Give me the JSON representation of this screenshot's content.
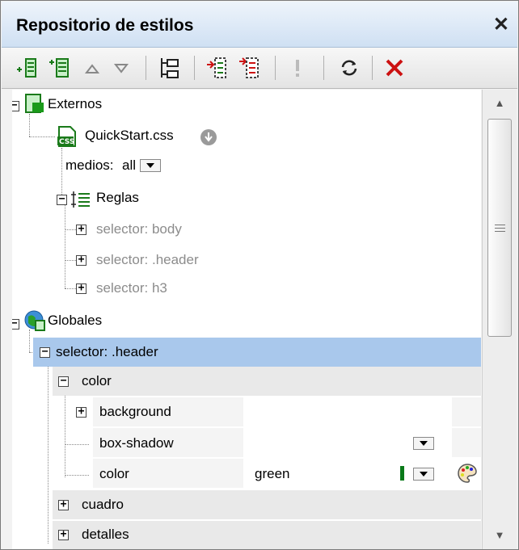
{
  "panel": {
    "title": "Repositorio de estilos",
    "close_label": "✕"
  },
  "toolbar": {
    "buttons": [
      "add-stylesheet-icon",
      "add-stylesheet-before-icon",
      "move-up-icon",
      "move-down-icon",
      "collapse-all-icon",
      "append-rule-icon",
      "insert-rule-icon",
      "important-icon",
      "reload-icon",
      "delete-icon"
    ]
  },
  "tree": {
    "externos": {
      "label": "Externos"
    },
    "quickstart": {
      "label": "QuickStart.css",
      "icon_text": "CSS"
    },
    "medios": {
      "label": "medios:",
      "value": "all"
    },
    "reglas": {
      "label": "Reglas"
    },
    "ext_selectors": [
      "selector: body",
      "selector: .header",
      "selector: h3"
    ],
    "globales": {
      "label": "Globales"
    },
    "selected_selector": "selector: .header",
    "props": {
      "color_group": "color",
      "background": "background",
      "box_shadow": "box-shadow",
      "color": "color",
      "color_value": "green",
      "cuadro": "cuadro",
      "detalles": "detalles"
    }
  },
  "colors": {
    "accent": "#a9c8ec",
    "green_swatch": "#0a7a1a",
    "delete": "#cc1111"
  }
}
